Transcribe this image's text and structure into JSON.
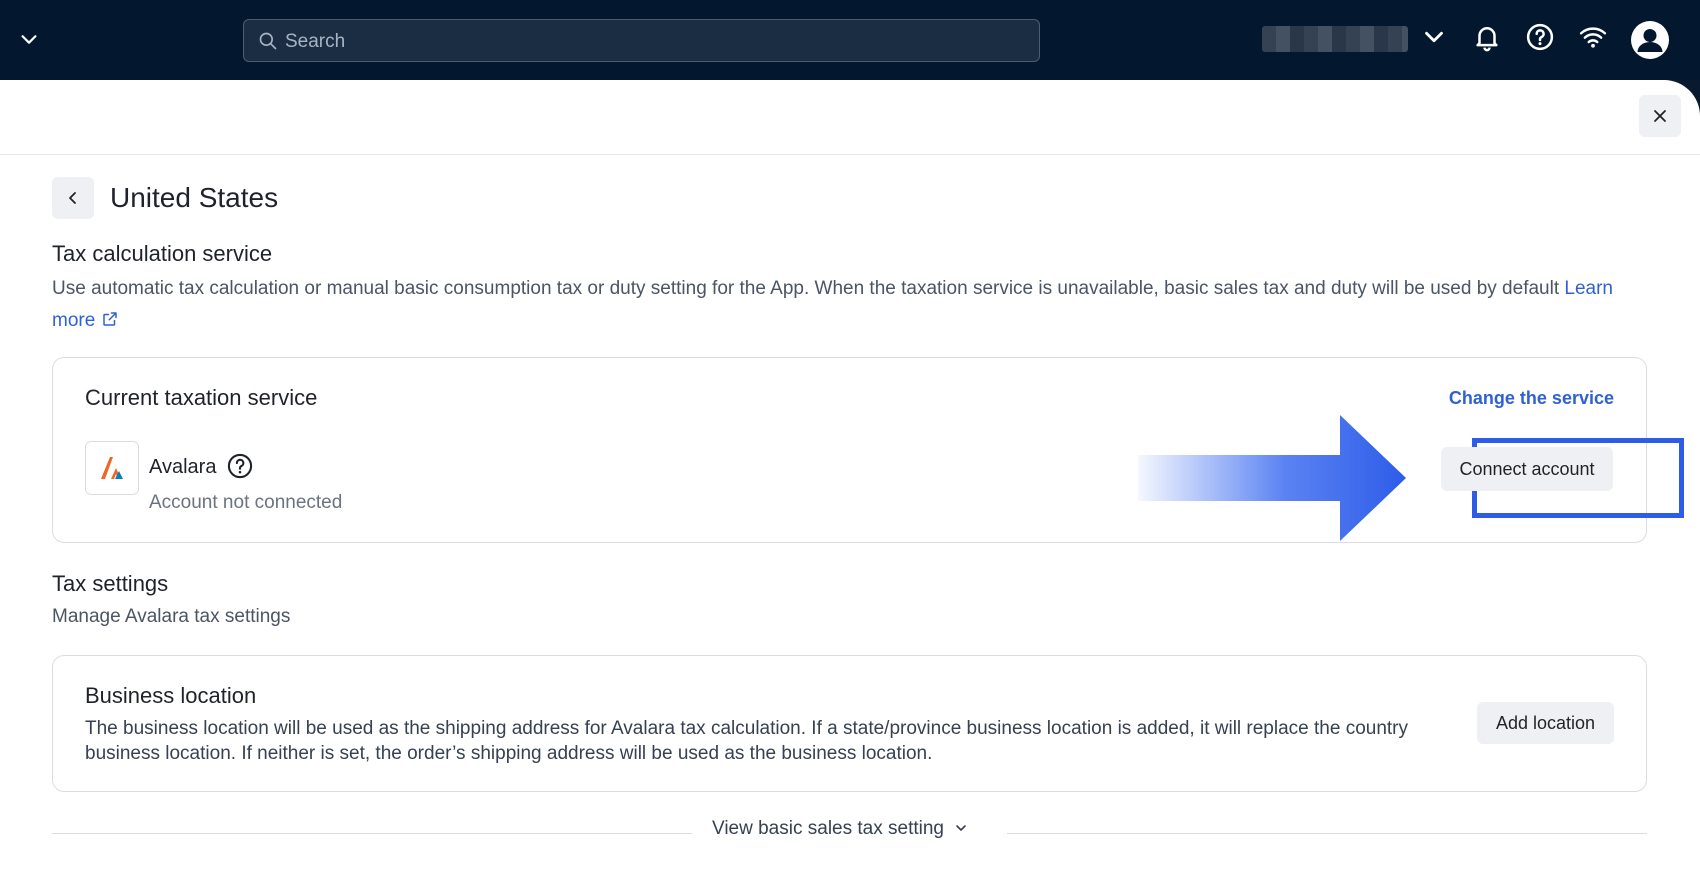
{
  "search": {
    "placeholder": "Search"
  },
  "page": {
    "title": "United States"
  },
  "tax_calc": {
    "title": "Tax calculation service",
    "description": "Use automatic tax calculation or manual basic consumption tax or duty setting for the App. When the taxation service is unavailable, basic sales tax and duty will be used by default",
    "learn_more": "Learn more"
  },
  "current_service": {
    "title": "Current taxation service",
    "change_link": "Change the service",
    "service_name": "Avalara",
    "status": "Account not connected",
    "connect_button": "Connect account"
  },
  "tax_settings": {
    "title": "Tax settings",
    "description": "Manage Avalara tax settings"
  },
  "business_location": {
    "title": "Business location",
    "description": "The business location will be used as the shipping address for Avalara tax calculation. If a state/province business location is added, it will replace the country business location. If neither is set, the order’s shipping address will be used as the business location.",
    "add_button": "Add location"
  },
  "view_basic": {
    "label": "View basic sales tax setting"
  },
  "colors": {
    "topbar": "#03182f",
    "link": "#2f61d5",
    "highlight": "#2d5ce8"
  }
}
